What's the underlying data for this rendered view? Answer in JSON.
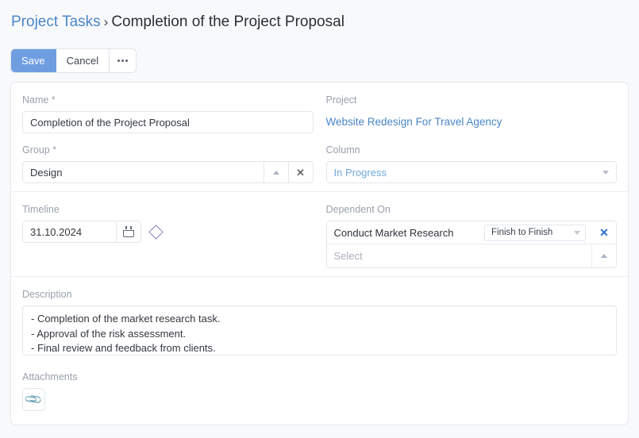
{
  "breadcrumb": {
    "parent_label": "Project Tasks",
    "separator": "›",
    "current_label": "Completion of the Project Proposal"
  },
  "toolbar": {
    "save_label": "Save",
    "cancel_label": "Cancel",
    "more_label": ""
  },
  "form": {
    "name": {
      "label": "Name *",
      "value": "Completion of the Project Proposal",
      "placeholder": ""
    },
    "project": {
      "label": "Project",
      "value": "Website Redesign For Travel Agency"
    },
    "group": {
      "label": "Group *",
      "value": "Design",
      "placeholder": ""
    },
    "column": {
      "label": "Column",
      "value": "In Progress"
    },
    "timeline": {
      "label": "Timeline",
      "value": "31.10.2024",
      "placeholder": ""
    },
    "dependent_on": {
      "label": "Dependent On",
      "rows": [
        {
          "name": "Conduct Market Research",
          "type": "Finish to Finish"
        }
      ],
      "add_placeholder": "Select"
    },
    "description": {
      "label": "Description",
      "value": "- Completion of the market research task.\n- Approval of the risk assessment.\n- Final review and feedback from clients."
    },
    "attachments": {
      "label": "Attachments",
      "clip_glyph": "📎"
    }
  },
  "colors": {
    "primary": "#6f9ee0",
    "link": "#4a86c8",
    "select_value": "#6fa8dc",
    "remove_blue": "#2f6fd0",
    "milestone": "#8f7fc0",
    "page_bg": "#f8f9fb",
    "card_bg": "#ffffff",
    "border": "#e3e6ed",
    "label": "#9aa1ad"
  }
}
